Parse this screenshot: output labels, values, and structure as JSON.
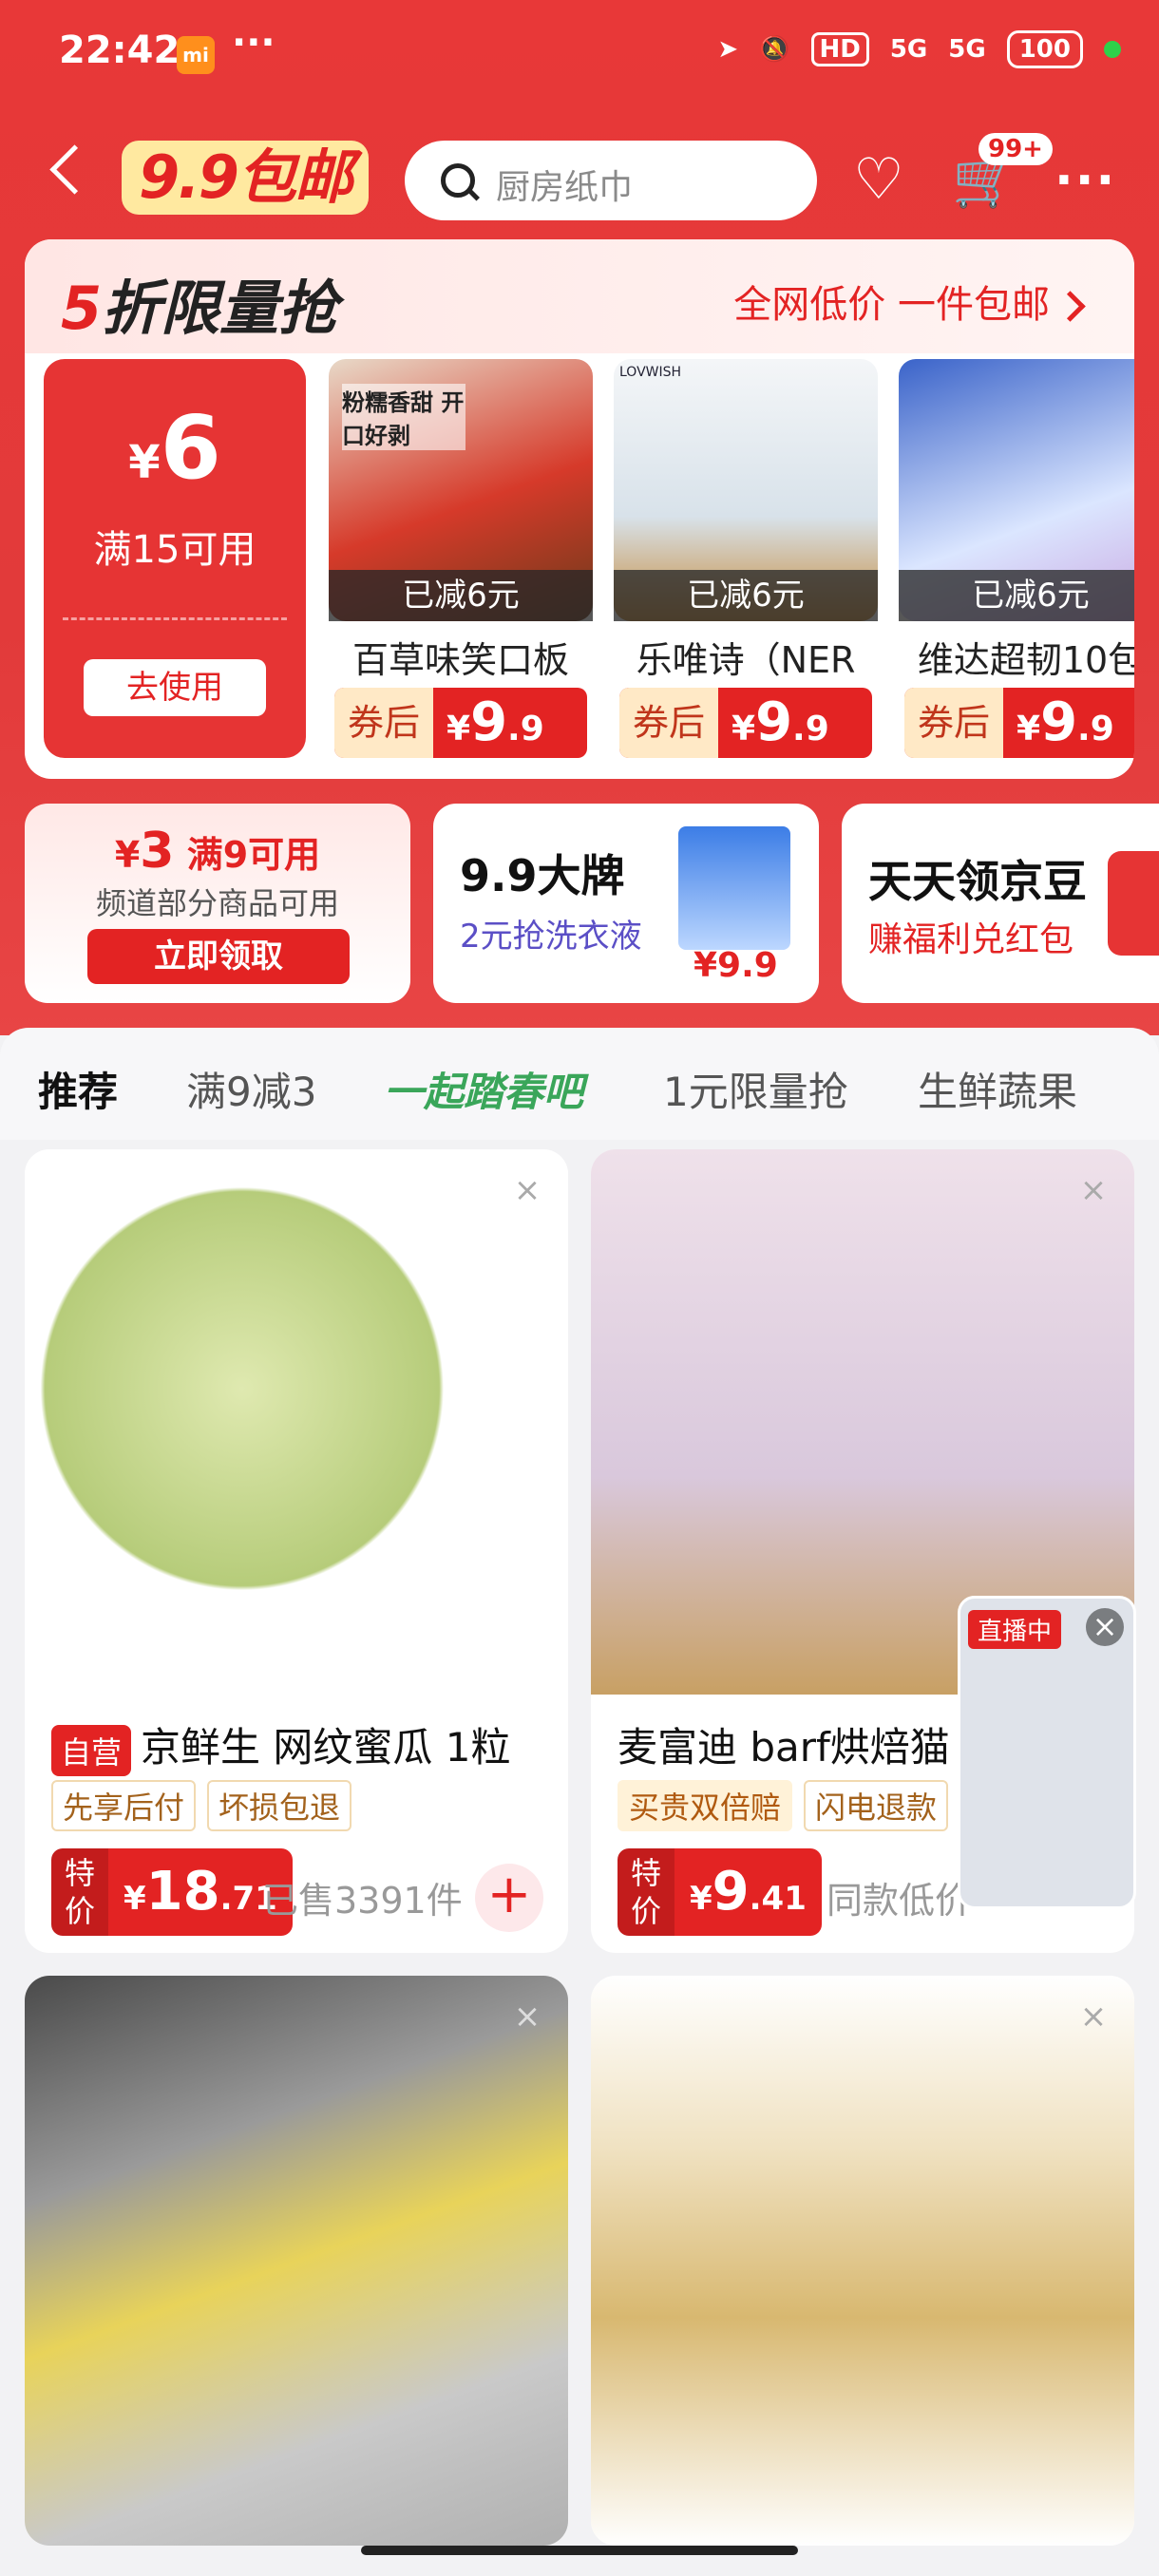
{
  "status_bar": {
    "time": "22:42",
    "mi": "mi",
    "dots": "···",
    "hd": "HD",
    "net1": "5G",
    "net2": "5G",
    "battery": "100"
  },
  "nav": {
    "brand": "9.9包邮",
    "search_placeholder": "厨房纸巾",
    "cart_badge": "99+",
    "more": "···"
  },
  "flash": {
    "title_num": "5",
    "title_rest": "折限量抢",
    "subtitle": "全网低价 一件包邮",
    "coupon": {
      "amount": "6",
      "currency": "¥",
      "condition": "满15可用",
      "button": "去使用"
    },
    "products": [
      {
        "cut": "已减6元",
        "name": "百草味笑口板",
        "after": "券后",
        "price": "9",
        "decimal": ".9",
        "currency": "¥",
        "img_text": "粉糯香甜 开口好剥"
      },
      {
        "cut": "已减6元",
        "name": "乐唯诗（NER",
        "after": "券后",
        "price": "9",
        "decimal": ".9",
        "currency": "¥",
        "img_text": "LOVWISH"
      },
      {
        "cut": "已减6元",
        "name": "维达超韧10包",
        "after": "券后",
        "price": "9",
        "decimal": ".9",
        "currency": "¥",
        "img_text": ""
      }
    ]
  },
  "promos": {
    "coupon3": {
      "currency": "¥",
      "amount": "3",
      "cond": "满9可用",
      "sub": "频道部分商品可用",
      "button": "立即领取"
    },
    "brand": {
      "title": "9.9大牌",
      "sub": "2元抢洗衣液",
      "price": "¥9.9"
    },
    "beans": {
      "title": "天天领京豆",
      "sub": "赚福利兑红包"
    }
  },
  "tabs": [
    "推荐",
    "满9减3",
    "一起踏春吧",
    "1元限量抢",
    "生鲜蔬果"
  ],
  "cards": [
    {
      "self_tag": "自营",
      "title": "京鲜生 网纹蜜瓜 1粒",
      "tags": [
        "先享后付",
        "坏损包退"
      ],
      "sp": "特价",
      "currency": "¥",
      "price": "18",
      "decimal": ".71",
      "sold": "已售3391件"
    },
    {
      "title": "麦富迪 barf烘焙猫",
      "tags": [
        "买贵双倍赔",
        "闪电退款"
      ],
      "sp": "特价",
      "currency": "¥",
      "price": "9",
      "decimal": ".41",
      "sold": "同款低价"
    },
    {
      "title": ""
    },
    {
      "title": ""
    }
  ],
  "live": {
    "label": "直播中"
  }
}
